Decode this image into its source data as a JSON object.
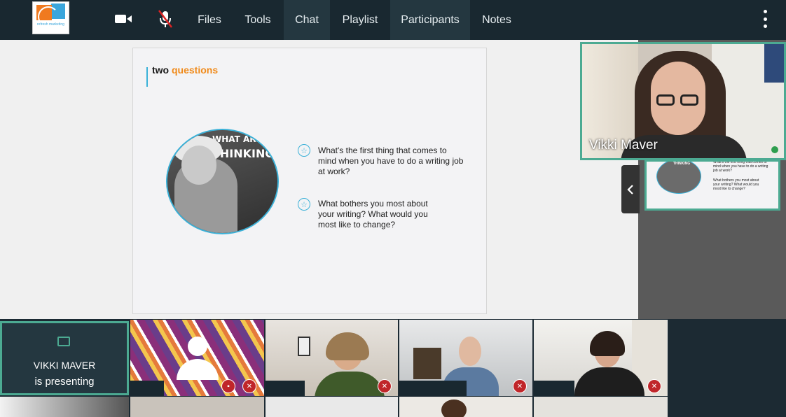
{
  "toolbar": {
    "logo_text": "refresh marketing",
    "tabs": [
      {
        "label": "Files"
      },
      {
        "label": "Tools"
      },
      {
        "label": "Chat"
      },
      {
        "label": "Playlist"
      },
      {
        "label": "Participants"
      },
      {
        "label": "Notes"
      }
    ],
    "active_tabs": [
      "Chat",
      "Participants"
    ]
  },
  "slide": {
    "title_part1": "two",
    "title_part2": "questions",
    "chalk_line1": "WHAT ARE",
    "chalk_line2": "THINKING",
    "questions": [
      {
        "text": "What's the first thing that comes to mind when you have to do a writing job at work?"
      },
      {
        "text": "What bothers you most about your writing? What would you most like to change?"
      }
    ]
  },
  "presenter": {
    "name": "Vikki Maver"
  },
  "thumbnail": {
    "chalk": "THINKING",
    "q1": "What's the first thing that comes to mind when you have to do a writing job at work?",
    "q2": "What bothers you most about your writing? What would you most like to change?"
  },
  "presenting_tile": {
    "name": "VIKKI MAVER",
    "status": "is presenting"
  },
  "colors": {
    "accent": "#4caa92",
    "orange": "#f08a1a",
    "blue": "#3ab1d8",
    "muted": "#c0262a"
  }
}
